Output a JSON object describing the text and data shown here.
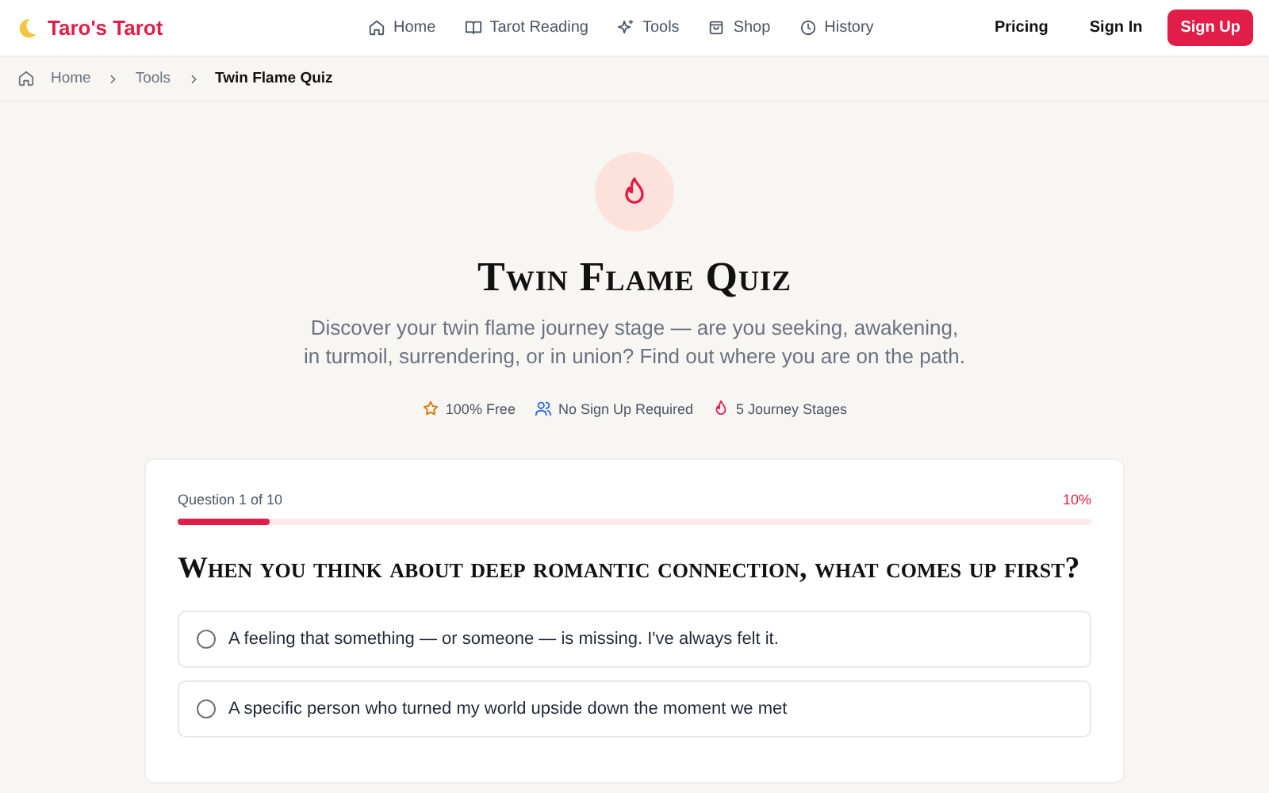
{
  "brand": {
    "name": "Taro's Tarot"
  },
  "nav": [
    {
      "label": "Home",
      "kind": "home"
    },
    {
      "label": "Tarot Reading",
      "kind": "book"
    },
    {
      "label": "Tools",
      "kind": "sparkle"
    },
    {
      "label": "Shop",
      "kind": "bag"
    },
    {
      "label": "History",
      "kind": "clock"
    }
  ],
  "actions": [
    {
      "label": "Pricing",
      "kind": "link"
    },
    {
      "label": "Sign In",
      "kind": "link"
    },
    {
      "label": "Sign Up",
      "kind": "primary"
    }
  ],
  "breadcrumb": [
    {
      "label": "Home",
      "current": false
    },
    {
      "label": "Tools",
      "current": false
    },
    {
      "label": "Twin Flame Quiz",
      "current": true
    }
  ],
  "hero": {
    "title": "Twin Flame Quiz",
    "description": "Discover your twin flame journey stage — are you seeking, awakening, in turmoil, surrendering, or in union? Find out where you are on the path.",
    "features": [
      {
        "label": "100% Free",
        "kind": "star"
      },
      {
        "label": "No Sign Up Required",
        "kind": "users"
      },
      {
        "label": "5 Journey Stages",
        "kind": "flame"
      }
    ]
  },
  "quiz": {
    "progress_label": "Question 1 of 10",
    "percent": "10%",
    "level": 0.1,
    "question": "When you think about deep romantic connection, what comes up first?",
    "options": [
      {
        "text": "A feeling that something — or someone — is missing. I've always felt it.",
        "selected": false
      },
      {
        "text": "A specific person who turned my world upside down the moment we met",
        "selected": false
      }
    ]
  }
}
